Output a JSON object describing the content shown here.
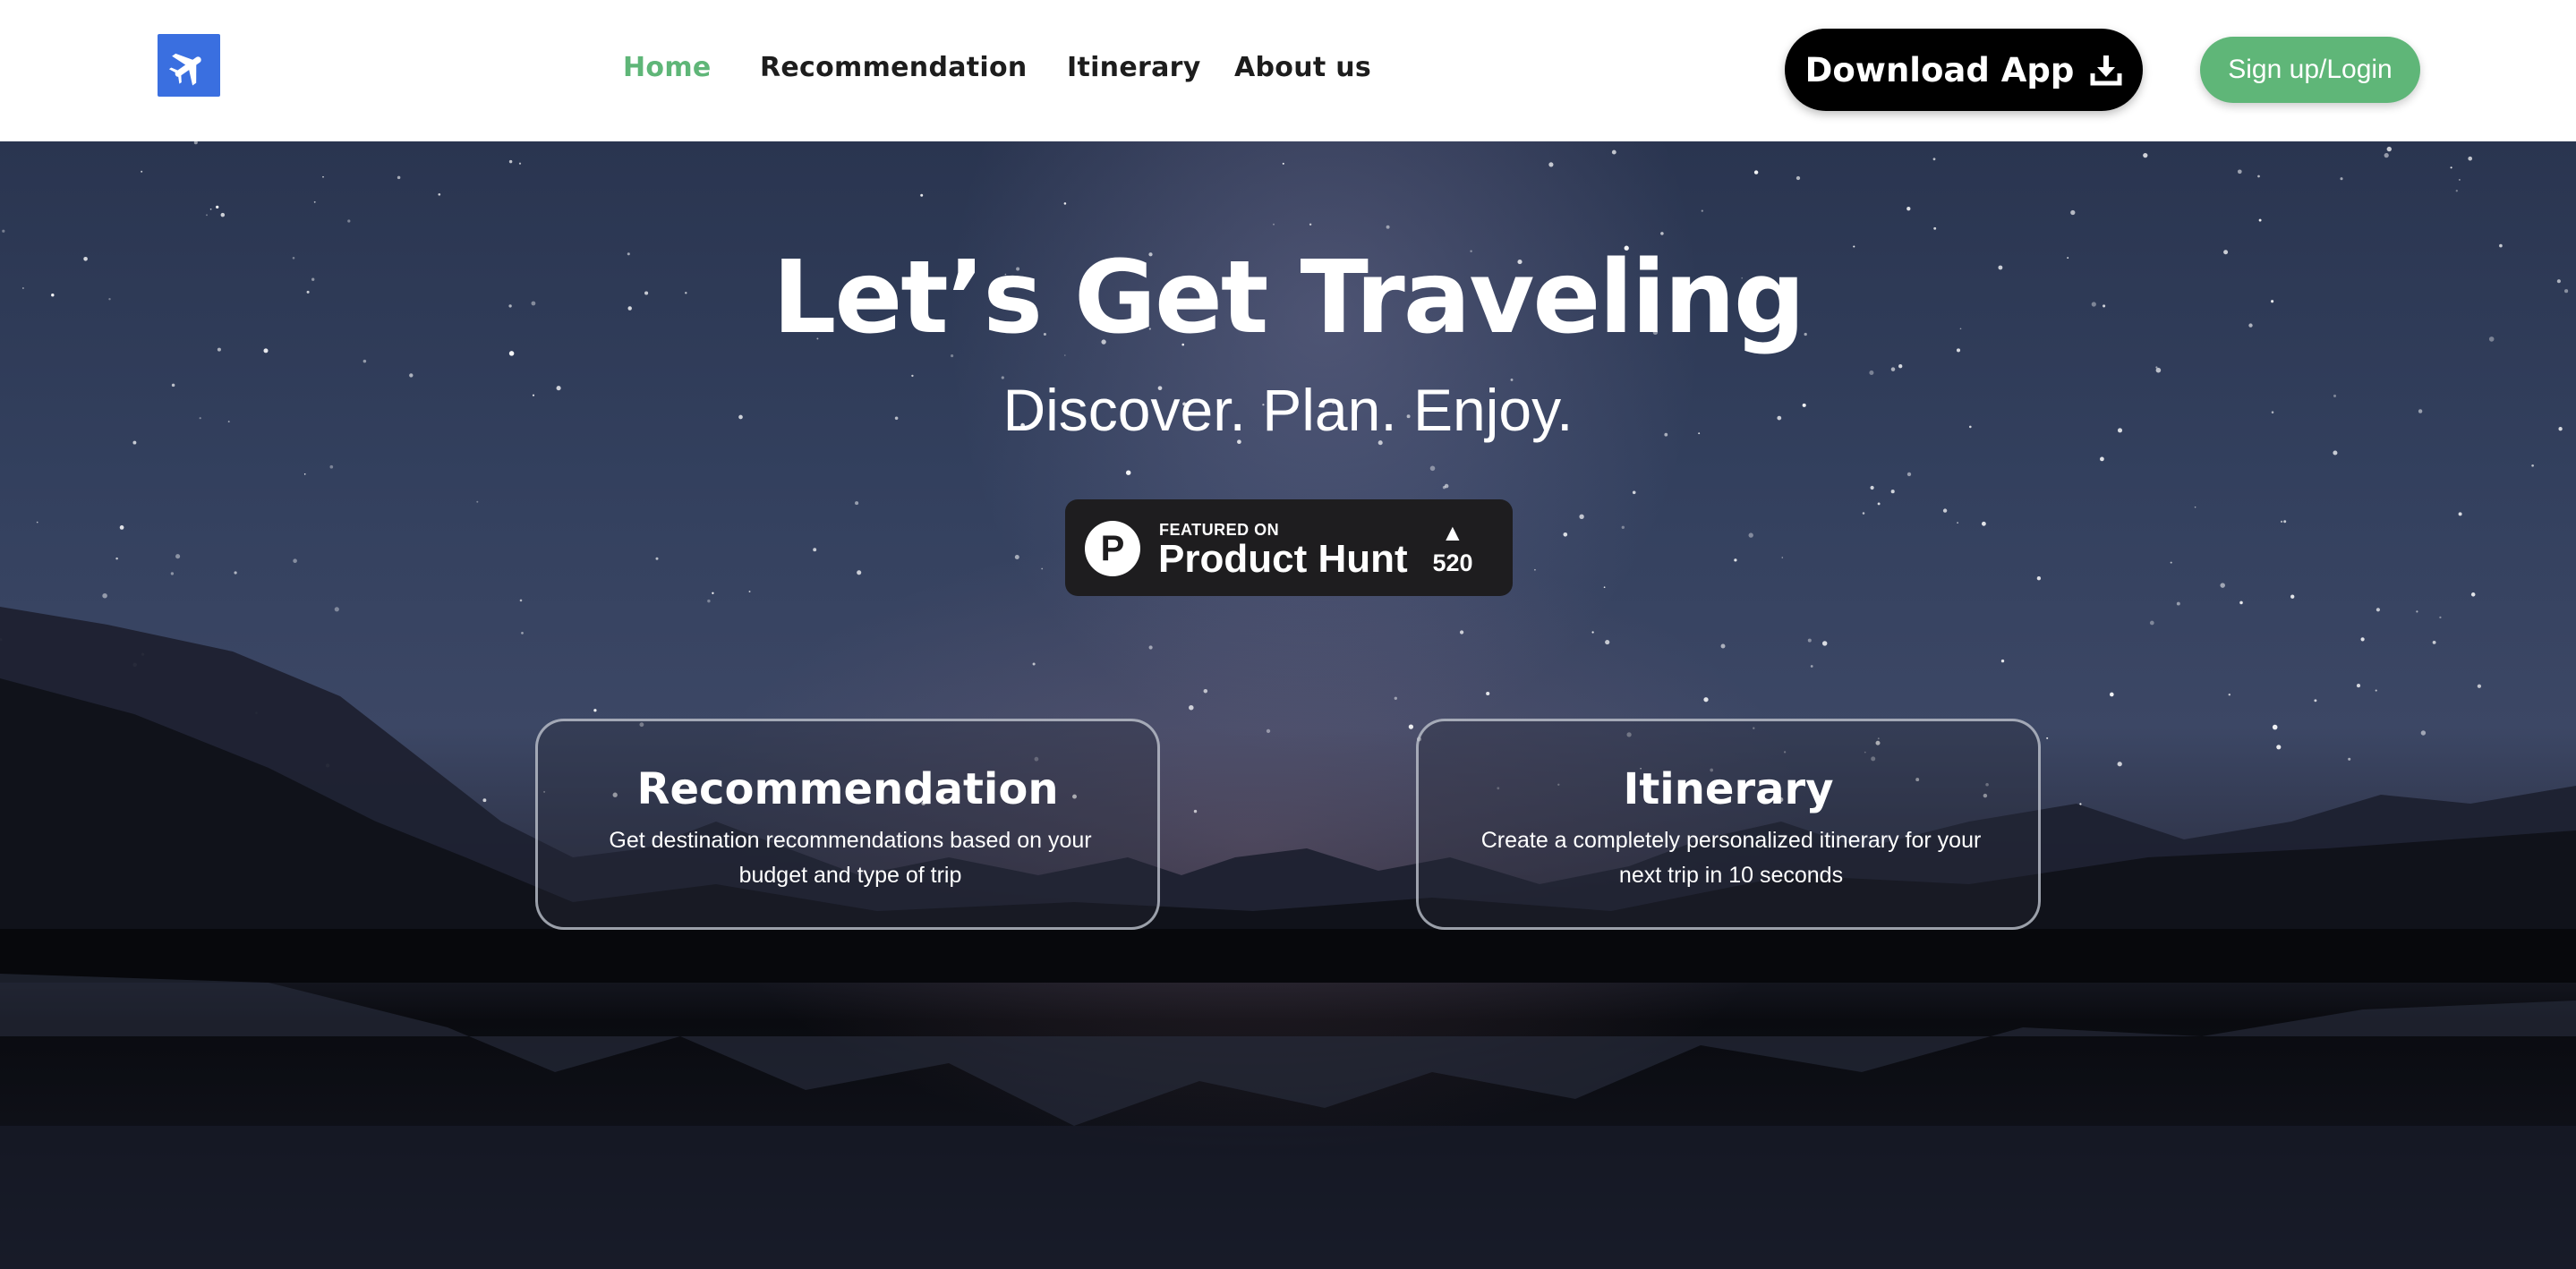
{
  "header": {
    "logo_icon": "airplane-icon",
    "nav": [
      {
        "label": "Home",
        "active": true
      },
      {
        "label": "Recommendation",
        "active": false
      },
      {
        "label": "Itinerary",
        "active": false
      },
      {
        "label": "About us",
        "active": false
      }
    ],
    "download_label": "Download App",
    "download_icon": "download-icon",
    "signup_label": "Sign up/Login"
  },
  "hero": {
    "title": "Let’s Get Traveling",
    "subtitle": "Discover. Plan. Enjoy.",
    "badge": {
      "logo_letter": "P",
      "featured_text": "FEATURED ON",
      "name": "Product Hunt",
      "arrow": "▲",
      "votes": "520"
    }
  },
  "cards": [
    {
      "title": "Recommendation",
      "description": "Get destination recommendations based on your budget and type of trip"
    },
    {
      "title": "Itinerary",
      "description": "Create a completely personalized itinerary for your next trip in 10 seconds"
    }
  ],
  "colors": {
    "accent_green": "#5fb678",
    "logo_blue": "#3a6fe0",
    "download_bg": "#000000"
  }
}
